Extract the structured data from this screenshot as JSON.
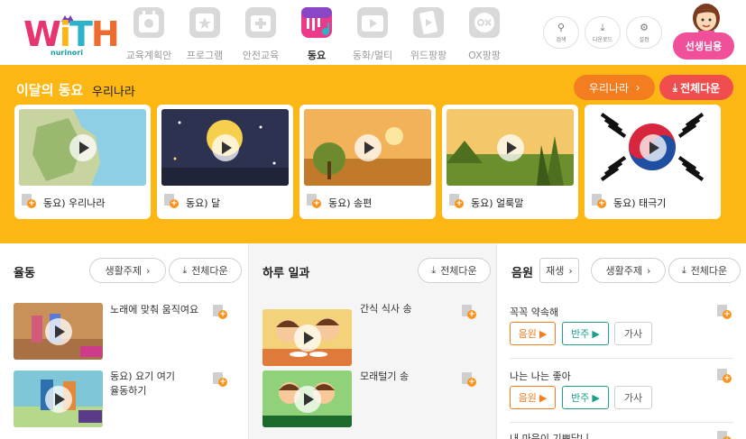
{
  "header": {
    "logo_text": "WiTH",
    "logo_sub": "nurinori",
    "nav": [
      {
        "label": "교육계획안",
        "icon": "calendar-icon"
      },
      {
        "label": "프로그램",
        "icon": "program-icon"
      },
      {
        "label": "안전교육",
        "icon": "first-aid-icon"
      },
      {
        "label": "동요",
        "icon": "music-icon",
        "active": true
      },
      {
        "label": "동화/멀티",
        "icon": "tv-icon"
      },
      {
        "label": "위드팡팡",
        "icon": "film-icon"
      },
      {
        "label": "OX팡팡",
        "icon": "ox-icon"
      }
    ],
    "tools": [
      {
        "label": "검색",
        "icon": "search-icon"
      },
      {
        "label": "다운로드",
        "icon": "download-icon"
      },
      {
        "label": "설정",
        "icon": "gear-icon"
      }
    ],
    "teacher_button": "선생님용"
  },
  "banner": {
    "title": "이달의 동요",
    "subtitle": "우리나라",
    "theme_button": "우리나라",
    "download_all": "전체다운",
    "cards": [
      {
        "title": "동요) 우리나라"
      },
      {
        "title": "동요) 달"
      },
      {
        "title": "동요) 송편"
      },
      {
        "title": "동요) 얼룩말"
      },
      {
        "title": "동요) 태극기"
      }
    ]
  },
  "movement": {
    "title": "율동",
    "topic_button": "생활주제",
    "download_all": "전체다운",
    "items": [
      {
        "title": "노래에 맞춰 움직여요"
      },
      {
        "title": "동요) 요기 여기\n율동하기"
      }
    ]
  },
  "daily": {
    "title": "하루 일과",
    "download_all": "전체다운",
    "items": [
      {
        "title": "간식 식사 송"
      },
      {
        "title": "모래털기 송"
      }
    ]
  },
  "audio": {
    "title": "음원",
    "play_button": "재생",
    "topic_button": "생활주제",
    "download_all": "전체다운",
    "source_label": "음원",
    "accomp_label": "반주",
    "lyrics_label": "가사",
    "tracks": [
      {
        "title": "꼭꼭 약속해"
      },
      {
        "title": "나는 나는 좋아"
      },
      {
        "title": "내 마음이 기쁘답니"
      }
    ]
  },
  "colors": {
    "banner": "#fdb714",
    "accent_orange": "#f47d20",
    "accent_red": "#f04e4e",
    "teacher_pink": "#f0509a",
    "teal": "#1aa08c"
  }
}
